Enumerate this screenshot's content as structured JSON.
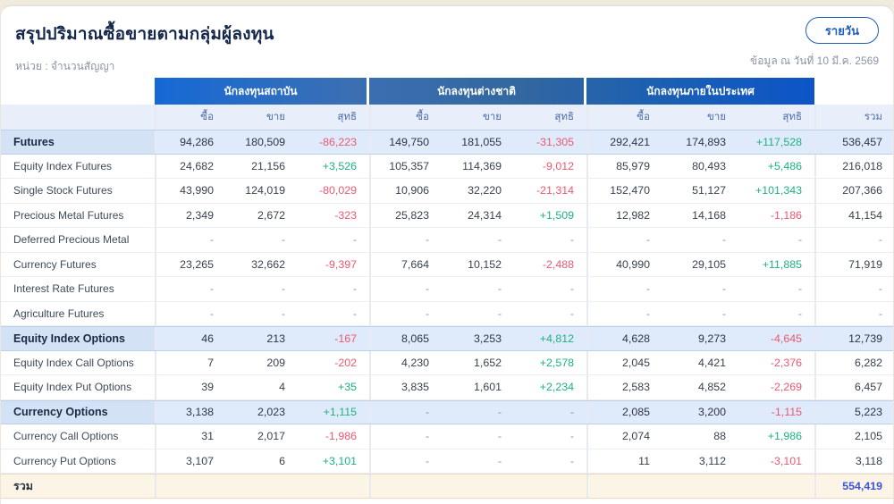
{
  "header": {
    "title": "สรุปปริมาณซื้อขายตามกลุ่มผู้ลงทุน",
    "unit": "หน่วย : จำนวนสัญญา",
    "view_button": "รายวัน",
    "as_of": "ข้อมูล ณ วันที่ 10 มี.ค. 2569"
  },
  "colors": {
    "header_blue_left": "#1569d6",
    "header_blue_mid": "#33679f",
    "header_blue_right": "#0d54c8",
    "accent_blue": "#1f5dba",
    "positive_green": "#1db183",
    "negative_red": "#ea5872",
    "total_value_blue": "#3b55d4",
    "section_row_bg": "#dfeafa",
    "total_row_bg": "#fcf4e6"
  },
  "table": {
    "groups": [
      "นักลงทุนสถาบัน",
      "นักลงทุนต่างชาติ",
      "นักลงทุนภายในประเทศ"
    ],
    "sub_headers": {
      "buy": "ซื้อ",
      "sell": "ขาย",
      "net": "สุทธิ"
    },
    "total_header": "รวม",
    "rows": [
      {
        "label": "Futures",
        "type": "section",
        "cells": [
          "94,286",
          "180,509",
          "-86,223",
          "149,750",
          "181,055",
          "-31,305",
          "292,421",
          "174,893",
          "+117,528",
          "536,457"
        ]
      },
      {
        "label": "Equity Index Futures",
        "type": "normal",
        "cells": [
          "24,682",
          "21,156",
          "+3,526",
          "105,357",
          "114,369",
          "-9,012",
          "85,979",
          "80,493",
          "+5,486",
          "216,018"
        ]
      },
      {
        "label": "Single Stock Futures",
        "type": "normal",
        "cells": [
          "43,990",
          "124,019",
          "-80,029",
          "10,906",
          "32,220",
          "-21,314",
          "152,470",
          "51,127",
          "+101,343",
          "207,366"
        ]
      },
      {
        "label": "Precious Metal Futures",
        "type": "normal",
        "cells": [
          "2,349",
          "2,672",
          "-323",
          "25,823",
          "24,314",
          "+1,509",
          "12,982",
          "14,168",
          "-1,186",
          "41,154"
        ]
      },
      {
        "label": "Deferred Precious Metal",
        "type": "normal",
        "cells": [
          "-",
          "-",
          "-",
          "-",
          "-",
          "-",
          "-",
          "-",
          "-",
          "-"
        ]
      },
      {
        "label": "Currency Futures",
        "type": "normal",
        "cells": [
          "23,265",
          "32,662",
          "-9,397",
          "7,664",
          "10,152",
          "-2,488",
          "40,990",
          "29,105",
          "+11,885",
          "71,919"
        ]
      },
      {
        "label": "Interest Rate Futures",
        "type": "normal",
        "cells": [
          "-",
          "-",
          "-",
          "-",
          "-",
          "-",
          "-",
          "-",
          "-",
          "-"
        ]
      },
      {
        "label": "Agriculture Futures",
        "type": "normal",
        "cells": [
          "-",
          "-",
          "-",
          "-",
          "-",
          "-",
          "-",
          "-",
          "-",
          "-"
        ]
      },
      {
        "label": "Equity Index Options",
        "type": "section",
        "cells": [
          "46",
          "213",
          "-167",
          "8,065",
          "3,253",
          "+4,812",
          "4,628",
          "9,273",
          "-4,645",
          "12,739"
        ]
      },
      {
        "label": "Equity Index Call Options",
        "type": "normal",
        "cells": [
          "7",
          "209",
          "-202",
          "4,230",
          "1,652",
          "+2,578",
          "2,045",
          "4,421",
          "-2,376",
          "6,282"
        ]
      },
      {
        "label": "Equity Index Put Options",
        "type": "normal",
        "cells": [
          "39",
          "4",
          "+35",
          "3,835",
          "1,601",
          "+2,234",
          "2,583",
          "4,852",
          "-2,269",
          "6,457"
        ]
      },
      {
        "label": "Currency Options",
        "type": "section",
        "cells": [
          "3,138",
          "2,023",
          "+1,115",
          "-",
          "-",
          "-",
          "2,085",
          "3,200",
          "-1,115",
          "5,223"
        ]
      },
      {
        "label": "Currency Call Options",
        "type": "normal",
        "cells": [
          "31",
          "2,017",
          "-1,986",
          "-",
          "-",
          "-",
          "2,074",
          "88",
          "+1,986",
          "2,105"
        ]
      },
      {
        "label": "Currency Put Options",
        "type": "normal",
        "cells": [
          "3,107",
          "6",
          "+3,101",
          "-",
          "-",
          "-",
          "11",
          "3,112",
          "-3,101",
          "3,118"
        ]
      },
      {
        "label": "รวม",
        "type": "total",
        "cells": [
          "",
          "",
          "",
          "",
          "",
          "",
          "",
          "",
          "",
          "554,419"
        ]
      }
    ]
  }
}
